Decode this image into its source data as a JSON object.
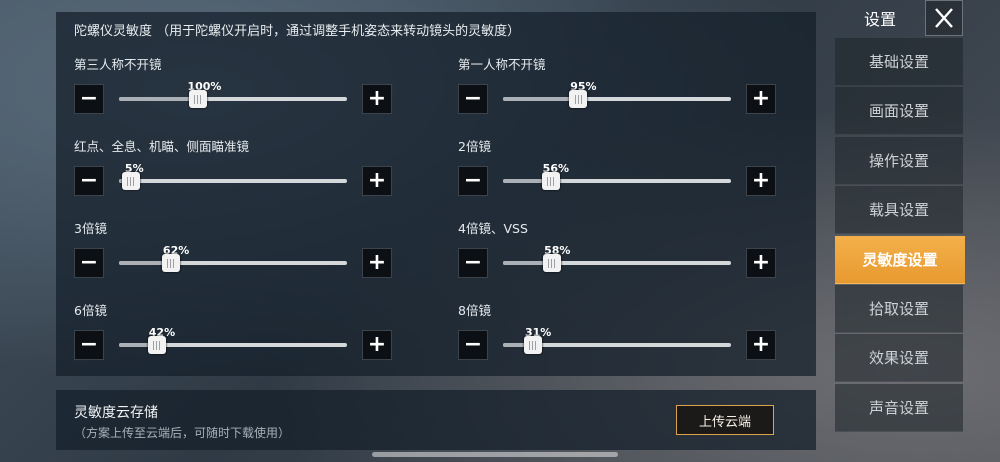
{
  "panel": {
    "title": "陀螺仪灵敏度 （用于陀螺仪开启时，通过调整手机姿态来转动镜头的灵敏度）",
    "minus_glyph": "−",
    "plus_glyph": "+",
    "sliders": [
      {
        "label": "第三人称不开镜",
        "percent": "100%",
        "value": 100
      },
      {
        "label": "第一人称不开镜",
        "percent": "95%",
        "value": 95
      },
      {
        "label": "红点、全息、机瞄、侧面瞄准镜",
        "percent": "5%",
        "value": 5
      },
      {
        "label": "2倍镜",
        "percent": "56%",
        "value": 56
      },
      {
        "label": "3倍镜",
        "percent": "62%",
        "value": 62
      },
      {
        "label": "4倍镜、VSS",
        "percent": "58%",
        "value": 58
      },
      {
        "label": "6倍镜",
        "percent": "42%",
        "value": 42
      },
      {
        "label": "8倍镜",
        "percent": "31%",
        "value": 31
      }
    ],
    "slider_max": 300
  },
  "cloud": {
    "title": "灵敏度云存储",
    "subtitle": "（方案上传至云端后，可随时下载使用）",
    "upload_label": "上传云端"
  },
  "sidebar": {
    "title": "设置",
    "close_icon": "close-icon",
    "items": [
      {
        "label": "基础设置",
        "active": false
      },
      {
        "label": "画面设置",
        "active": false
      },
      {
        "label": "操作设置",
        "active": false
      },
      {
        "label": "载具设置",
        "active": false
      },
      {
        "label": "灵敏度设置",
        "active": true
      },
      {
        "label": "拾取设置",
        "active": false
      },
      {
        "label": "效果设置",
        "active": false
      },
      {
        "label": "声音设置",
        "active": false
      }
    ]
  },
  "colors": {
    "accent": "#e89b2f",
    "upload_border": "#d9a44a"
  }
}
